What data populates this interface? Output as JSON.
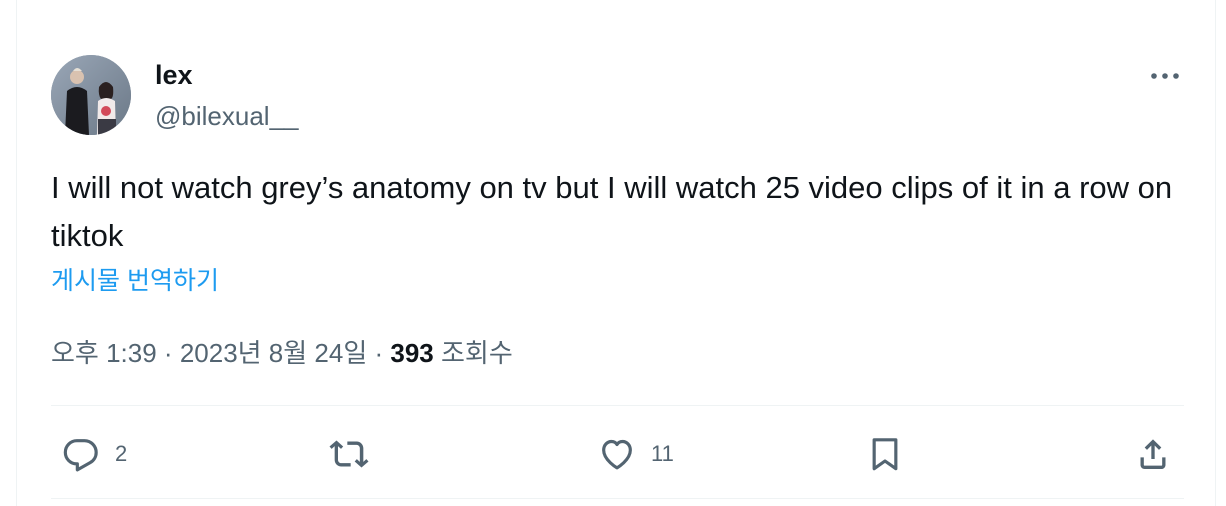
{
  "author": {
    "display_name": "lex",
    "handle": "@bilexual__"
  },
  "tweet": {
    "text": "I will not watch grey’s anatomy on tv but I will watch 25 video clips of it in a row on tiktok",
    "translate_label": "게시물 번역하기"
  },
  "meta": {
    "time": "오후 1:39",
    "separator": "·",
    "date": "2023년 8월 24일",
    "views_count": "393",
    "views_label": "조회수"
  },
  "actions": {
    "reply_count": "2",
    "like_count": "11"
  },
  "icons": {
    "more": "more-horizontal-icon",
    "reply": "reply-icon",
    "retweet": "retweet-icon",
    "like": "heart-icon",
    "bookmark": "bookmark-icon",
    "share": "share-icon"
  },
  "colors": {
    "text": "#0f1419",
    "secondary": "#536471",
    "link": "#1d9bf0",
    "divider": "#eff3f4"
  }
}
